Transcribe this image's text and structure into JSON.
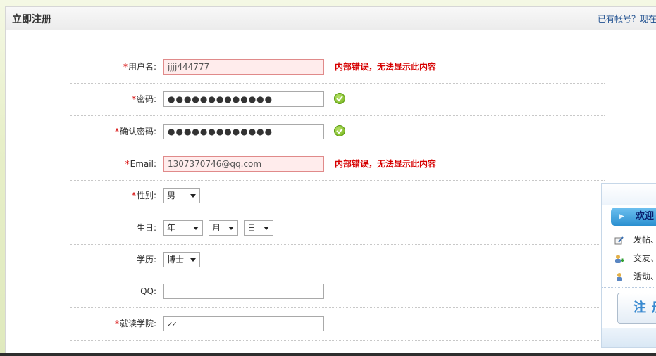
{
  "header": {
    "title": "立即注册",
    "login_link": "已有帐号？现在"
  },
  "form": {
    "required_mark": "*",
    "username": {
      "label": "用户名:",
      "value": "jjjj444777",
      "error": "内部错误，无法显示此内容"
    },
    "password": {
      "label": "密码:",
      "value": "●●●●●●●●●●●●●",
      "status": "ok"
    },
    "confirm_password": {
      "label": "确认密码:",
      "value": "●●●●●●●●●●●●●",
      "status": "ok"
    },
    "email": {
      "label": "Email:",
      "value": "1307370746@qq.com",
      "error": "内部错误，无法显示此内容"
    },
    "gender": {
      "label": "性别:",
      "selected": "男"
    },
    "birthday": {
      "label": "生日:",
      "year": "年",
      "month": "月",
      "day": "日"
    },
    "education": {
      "label": "学历:",
      "selected": "博士"
    },
    "qq": {
      "label": "QQ:",
      "value": ""
    },
    "school": {
      "label": "就读学院:",
      "value": "zz"
    }
  },
  "sidebar": {
    "tab_label": "欢迎",
    "items": [
      "发帖、",
      "交友、",
      "活动、"
    ],
    "register_button": "注册"
  },
  "colors": {
    "error_text": "#d60000",
    "error_field_bg": "#ffecec",
    "ok_green": "#6fae14",
    "link_blue": "#1f4f8f"
  }
}
